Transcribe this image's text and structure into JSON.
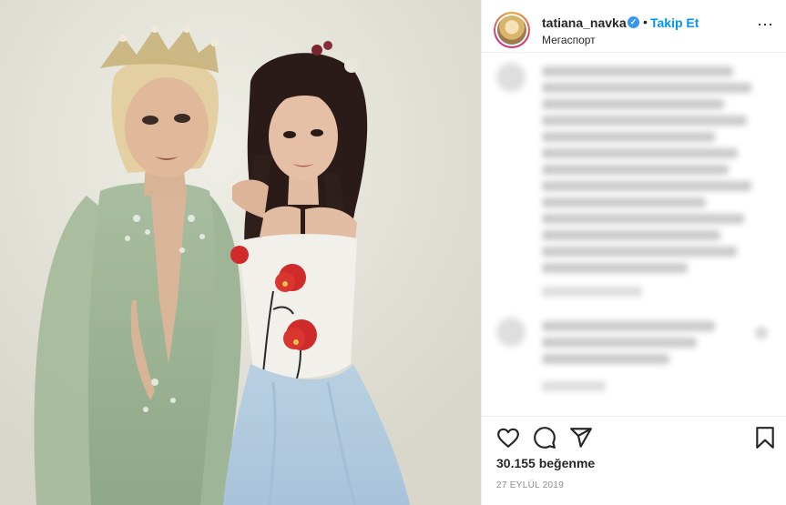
{
  "post": {
    "username": "tatiana_navka",
    "separator": "•",
    "follow_label": "Takip Et",
    "location": "Мегаспорт",
    "more_icon": "more-icon",
    "likes_count": "30.155",
    "likes_label": "beğenme",
    "date": "27 EYLÜL 2019"
  },
  "icons": {
    "like": "heart-icon",
    "comment": "comment-icon",
    "share": "share-icon",
    "save": "bookmark-icon",
    "verified": "verified-badge-icon"
  },
  "colors": {
    "follow": "#0095f6",
    "verified": "#3897f0",
    "text": "#262626",
    "muted": "#8e8e8e"
  }
}
